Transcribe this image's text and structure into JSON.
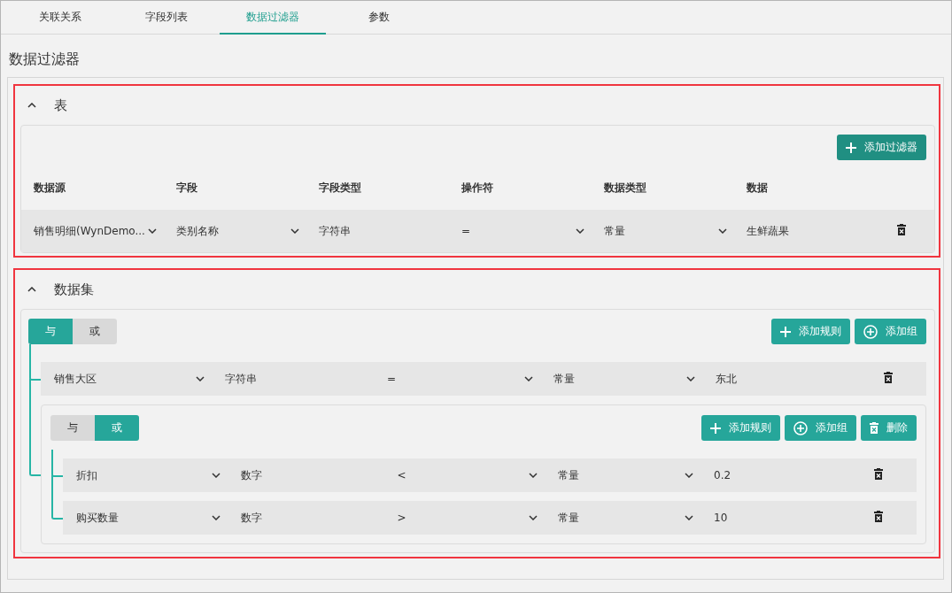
{
  "tabs": [
    {
      "label": "关联关系",
      "selected": false
    },
    {
      "label": "字段列表",
      "selected": false
    },
    {
      "label": "数据过滤器",
      "selected": true
    },
    {
      "label": "参数",
      "selected": false
    }
  ],
  "heading": "数据过滤器",
  "table_section": {
    "title": "表",
    "expanded": true,
    "add_button": "添加过滤器",
    "columns": [
      "数据源",
      "字段",
      "字段类型",
      "操作符",
      "数据类型",
      "数据"
    ],
    "rows": [
      {
        "cells": [
          {
            "kind": "select",
            "text": "销售明细(WynDemo..."
          },
          {
            "kind": "select",
            "text": "类别名称"
          },
          {
            "kind": "text",
            "text": "字符串"
          },
          {
            "kind": "select",
            "text": "="
          },
          {
            "kind": "select",
            "text": "常量"
          },
          {
            "kind": "text",
            "text": "生鲜蔬果"
          }
        ]
      }
    ]
  },
  "dataset_section": {
    "title": "数据集",
    "expanded": true,
    "group": {
      "operators": [
        {
          "label": "与",
          "selected": true
        },
        {
          "label": "或",
          "selected": false
        }
      ],
      "buttons": [
        {
          "kind": "add_rule",
          "label": "添加规则"
        },
        {
          "kind": "add_group",
          "label": "添加组"
        }
      ],
      "children": [
        {
          "kind": "rule",
          "field": "销售大区",
          "type": "字符串",
          "operator": "=",
          "value_type": "常量",
          "value": "东北"
        },
        {
          "kind": "group",
          "operators": [
            {
              "label": "与",
              "selected": false
            },
            {
              "label": "或",
              "selected": true
            }
          ],
          "buttons": [
            {
              "kind": "add_rule",
              "label": "添加规则"
            },
            {
              "kind": "add_group",
              "label": "添加组"
            },
            {
              "kind": "delete",
              "label": "删除"
            }
          ],
          "children": [
            {
              "kind": "rule",
              "field": "折扣",
              "type": "数字",
              "operator": "<",
              "value_type": "常量",
              "value": "0.2"
            },
            {
              "kind": "rule",
              "field": "购买数量",
              "type": "数字",
              "operator": ">",
              "value_type": "常量",
              "value": "10"
            }
          ]
        }
      ]
    }
  }
}
